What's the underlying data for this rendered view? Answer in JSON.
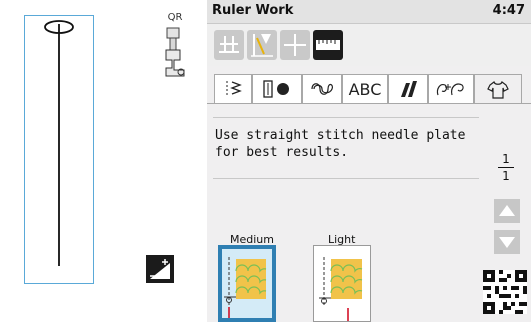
{
  "left": {
    "foot_code": "QR",
    "adjust_icon": "contrast-adjust-icon"
  },
  "header": {
    "title": "Ruler Work",
    "time": "4:47"
  },
  "mode_buttons": [
    {
      "name": "sewing-mode-icon",
      "active": false
    },
    {
      "name": "needle-light-icon",
      "active": false
    },
    {
      "name": "crosshair-icon",
      "active": false
    },
    {
      "name": "ruler-icon",
      "active": true
    }
  ],
  "tabs": [
    {
      "name": "utility-stitch-tab-icon",
      "label": ""
    },
    {
      "name": "buttonhole-tab-icon",
      "label": ""
    },
    {
      "name": "decorative-stitch-tab-icon",
      "label": ""
    },
    {
      "name": "alphabet-tab",
      "label": "ABC"
    },
    {
      "name": "satin-stitch-tab-icon",
      "label": ""
    },
    {
      "name": "character-tab-icon",
      "label": ""
    },
    {
      "name": "shirt-tab-icon",
      "label": "",
      "active": true
    }
  ],
  "message": {
    "line1": "Use straight stitch needle plate",
    "line2": "for best results."
  },
  "page": {
    "current": "1",
    "total": "1"
  },
  "options": [
    {
      "label": "Medium",
      "selected": true
    },
    {
      "label": "Light",
      "selected": false
    }
  ],
  "colors": {
    "accent": "#2f7fb2",
    "quilt_fill": "#f1c34a",
    "quilt_line": "#7abf56",
    "ruler_marker": "#d0021b"
  }
}
